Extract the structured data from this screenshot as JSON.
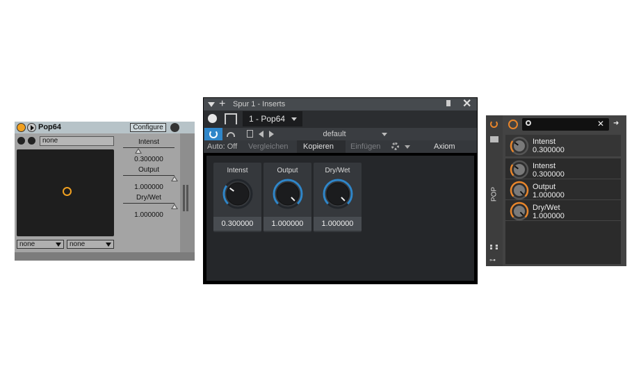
{
  "live": {
    "title": "Pop64",
    "configure_label": "Configure",
    "preset": "none",
    "params": [
      {
        "label": "Intenst",
        "value": "0.300000",
        "fraction": 0.3
      },
      {
        "label": "Output",
        "value": "1.000000",
        "fraction": 1.0
      },
      {
        "label": "Dry/Wet",
        "value": "1.000000",
        "fraction": 1.0
      }
    ],
    "dropdowns": [
      "none",
      "none"
    ],
    "accent": "#f0a020"
  },
  "studio": {
    "header": "Spur 1 - Inserts",
    "tab": "1 - Pop64",
    "preset": "default",
    "auto": "Auto: Off",
    "compare": "Vergleichen",
    "copy": "Kopieren",
    "paste": "Einfügen",
    "device": "Axiom",
    "knobs": [
      {
        "label": "Intenst",
        "value": "0.300000",
        "fraction": 0.3
      },
      {
        "label": "Output",
        "value": "1.000000",
        "fraction": 1.0
      },
      {
        "label": "Dry/Wet",
        "value": "1.000000",
        "fraction": 1.0
      }
    ],
    "accent": "#2f86c9"
  },
  "bitwig": {
    "search_placeholder": "",
    "vertical_label": "POP",
    "remote": {
      "name": "Intenst",
      "value": "0.300000",
      "fraction": 0.3
    },
    "params": [
      {
        "name": "Intenst",
        "value": "0.300000",
        "fraction": 0.3
      },
      {
        "name": "Output",
        "value": "1.000000",
        "fraction": 1.0
      },
      {
        "name": "Dry/Wet",
        "value": "1.000000",
        "fraction": 1.0
      }
    ],
    "accent": "#e8852a"
  }
}
